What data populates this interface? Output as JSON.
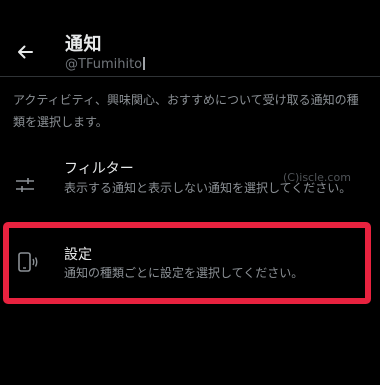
{
  "header": {
    "back_label": "←",
    "title": "通知",
    "handle": "@TFumihito"
  },
  "description": "アクティビティ、興味関心、おすすめについて受け取る通知の種類を選択します。",
  "items": [
    {
      "label": "フィルター",
      "sub": "表示する通知と表示しない通知を選択してください。",
      "icon": "sliders-icon"
    },
    {
      "label": "設定",
      "sub": "通知の種類ごとに設定を選択してください。",
      "icon": "phone-vibrate-icon"
    }
  ],
  "watermark": "(C)iscle.com",
  "colors": {
    "background": "#000000",
    "primary_text": "#e7e9ea",
    "secondary_text": "#8b9095",
    "highlight": "#e8223f"
  }
}
